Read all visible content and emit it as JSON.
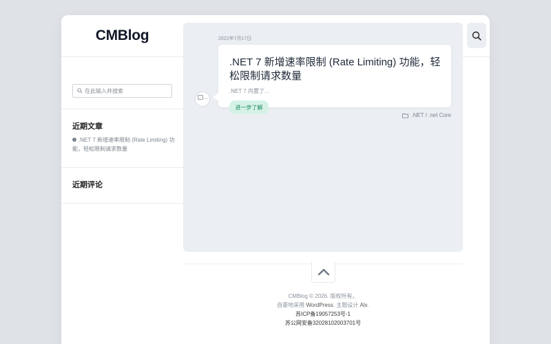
{
  "site": {
    "title": "CMBlog"
  },
  "search": {
    "placeholder": "在此输入并搜索"
  },
  "widgets": {
    "recent_posts_title": "近期文章",
    "recent_posts": [
      {
        "label": ".NET 7 新增速率限制 (Rate Limiting) 功能，轻松限制请求数量"
      }
    ],
    "recent_comments_title": "近期评论"
  },
  "post": {
    "date": "2022年7月17日",
    "title": ".NET 7 新增速率限制 (Rate Limiting) 功能，轻松限制请求数量",
    "excerpt": ".NET 7  内置了...",
    "read_more": "进一步了解",
    "avatar_alt": "...",
    "category": ".NET / .net Core"
  },
  "footer": {
    "copyright": "CMBlog © 2026. 版权所有。",
    "powered_prefix": "自豪地采用 ",
    "powered_link": "WordPress",
    "theme_prefix": ". 主题设计 ",
    "theme_link": "Alx",
    "theme_suffix": ".",
    "icp": "苏ICP备19057253号-1",
    "police": "苏公网安备32028102003701号"
  },
  "icons": {
    "search": "search-icon",
    "folder": "folder-icon",
    "back_to_top": "chevron-up-icon",
    "bullet": "circle-bullet-icon"
  },
  "colors": {
    "page_bg": "#dfe3e8",
    "panel_bg": "#ebeef2",
    "accent_bg": "#d6f2e7",
    "accent_text": "#1b8a5f"
  }
}
